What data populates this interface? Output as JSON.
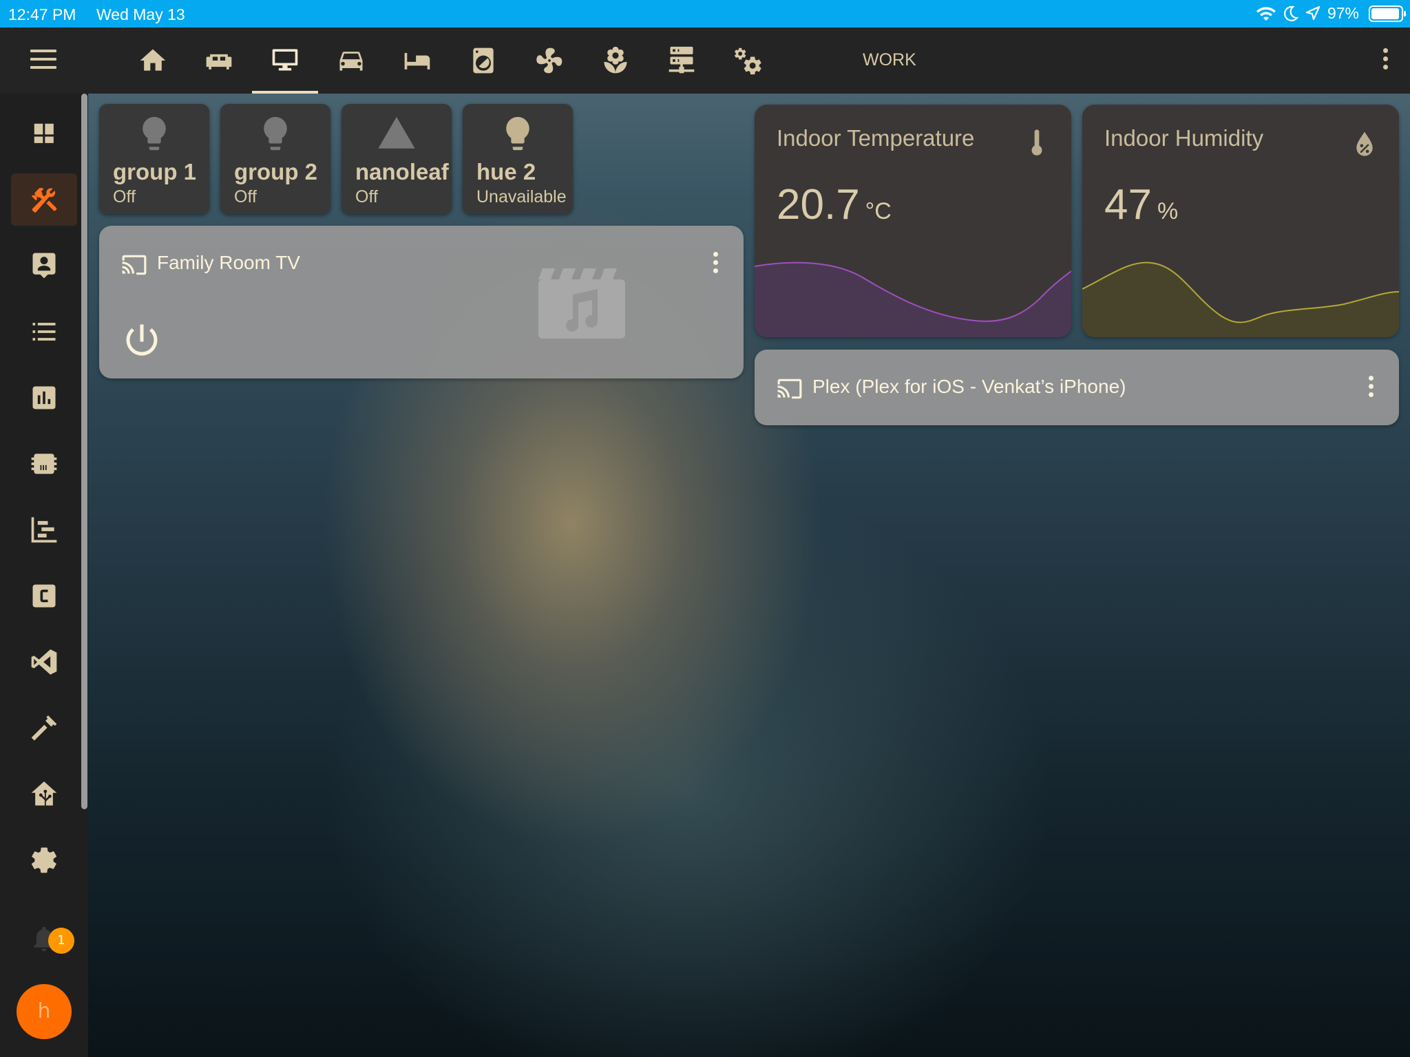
{
  "status_bar": {
    "time": "12:47 PM",
    "date": "Wed May 13",
    "battery": "97%",
    "icons": [
      "wifi-icon",
      "moon-icon",
      "location-arrow-icon",
      "battery-icon"
    ]
  },
  "top_bar": {
    "tabs": [
      {
        "icon": "home-icon",
        "active": false
      },
      {
        "icon": "sofa-icon",
        "active": false
      },
      {
        "icon": "monitor-icon",
        "active": true
      },
      {
        "icon": "car-icon",
        "active": false
      },
      {
        "icon": "bed-icon",
        "active": false
      },
      {
        "icon": "washing-machine-icon",
        "active": false
      },
      {
        "icon": "fan-icon",
        "active": false
      },
      {
        "icon": "flower-icon",
        "active": false
      },
      {
        "icon": "server-icon",
        "active": false
      },
      {
        "icon": "cogs-icon",
        "active": false
      }
    ],
    "work_label": "WORK"
  },
  "sidebar": {
    "items": [
      "dashboard-icon",
      "tools-icon",
      "account-box-icon",
      "list-icon",
      "chart-icon",
      "chip-icon",
      "gantt-icon",
      "c-box-icon",
      "vscode-icon",
      "hammer-icon",
      "home-assistant-icon",
      "settings-icon"
    ],
    "active_index": 1,
    "notification_count": "1",
    "avatar_initial": "h"
  },
  "entity_buttons": [
    {
      "name": "group 1",
      "state": "Off",
      "icon": "lightbulb-icon"
    },
    {
      "name": "group 2",
      "state": "Off",
      "icon": "lightbulb-icon"
    },
    {
      "name": "nanoleaf",
      "state": "Off",
      "icon": "triangle-icon"
    },
    {
      "name": "hue 2",
      "state": "Unavailable",
      "icon": "lightbulb-icon"
    }
  ],
  "media": {
    "family_room": {
      "title": "Family Room TV"
    },
    "plex": {
      "title": "Plex (Plex for iOS - Venkat’s iPhone)"
    }
  },
  "sensors": {
    "temperature": {
      "title": "Indoor Temperature",
      "value": "20.7",
      "unit": "°C",
      "color": "#a04fc0"
    },
    "humidity": {
      "title": "Indoor Humidity",
      "value": "47",
      "unit": "%",
      "color": "#b6a832"
    }
  },
  "colors": {
    "status_bar": "#04a9f0",
    "accent": "#ff6f1a",
    "icon": "#d7c9a7",
    "badge": "#ff9800"
  }
}
